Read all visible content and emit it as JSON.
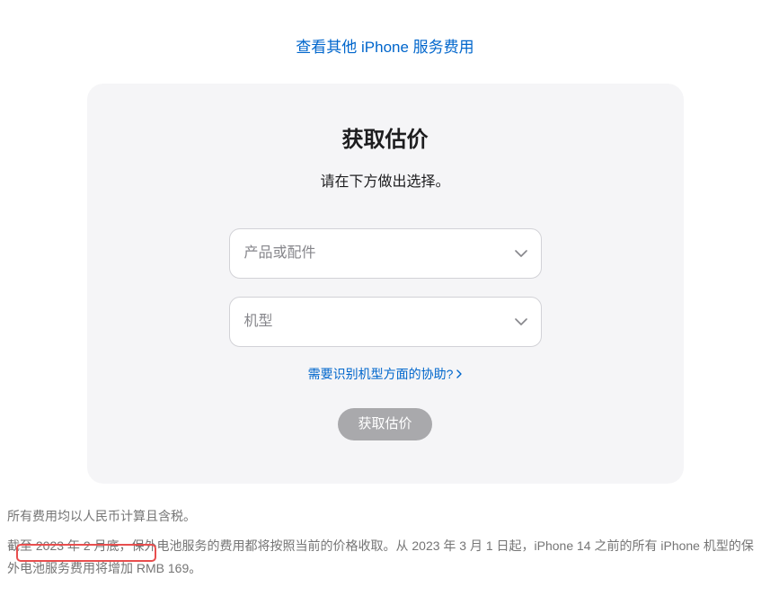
{
  "top_link": {
    "label": "查看其他 iPhone 服务费用"
  },
  "card": {
    "title": "获取估价",
    "subtitle": "请在下方做出选择。",
    "select_product": {
      "placeholder": "产品或配件"
    },
    "select_model": {
      "placeholder": "机型"
    },
    "help_link": "需要识别机型方面的协助?",
    "submit_button": "获取估价"
  },
  "footer": {
    "line1": "所有费用均以人民币计算且含税。",
    "line2": "截至 2023 年 2 月底，保外电池服务的费用都将按照当前的价格收取。从 2023 年 3 月 1 日起，iPhone 14 之前的所有 iPhone 机型的保外电池服务费用将增加 RMB 169。"
  }
}
